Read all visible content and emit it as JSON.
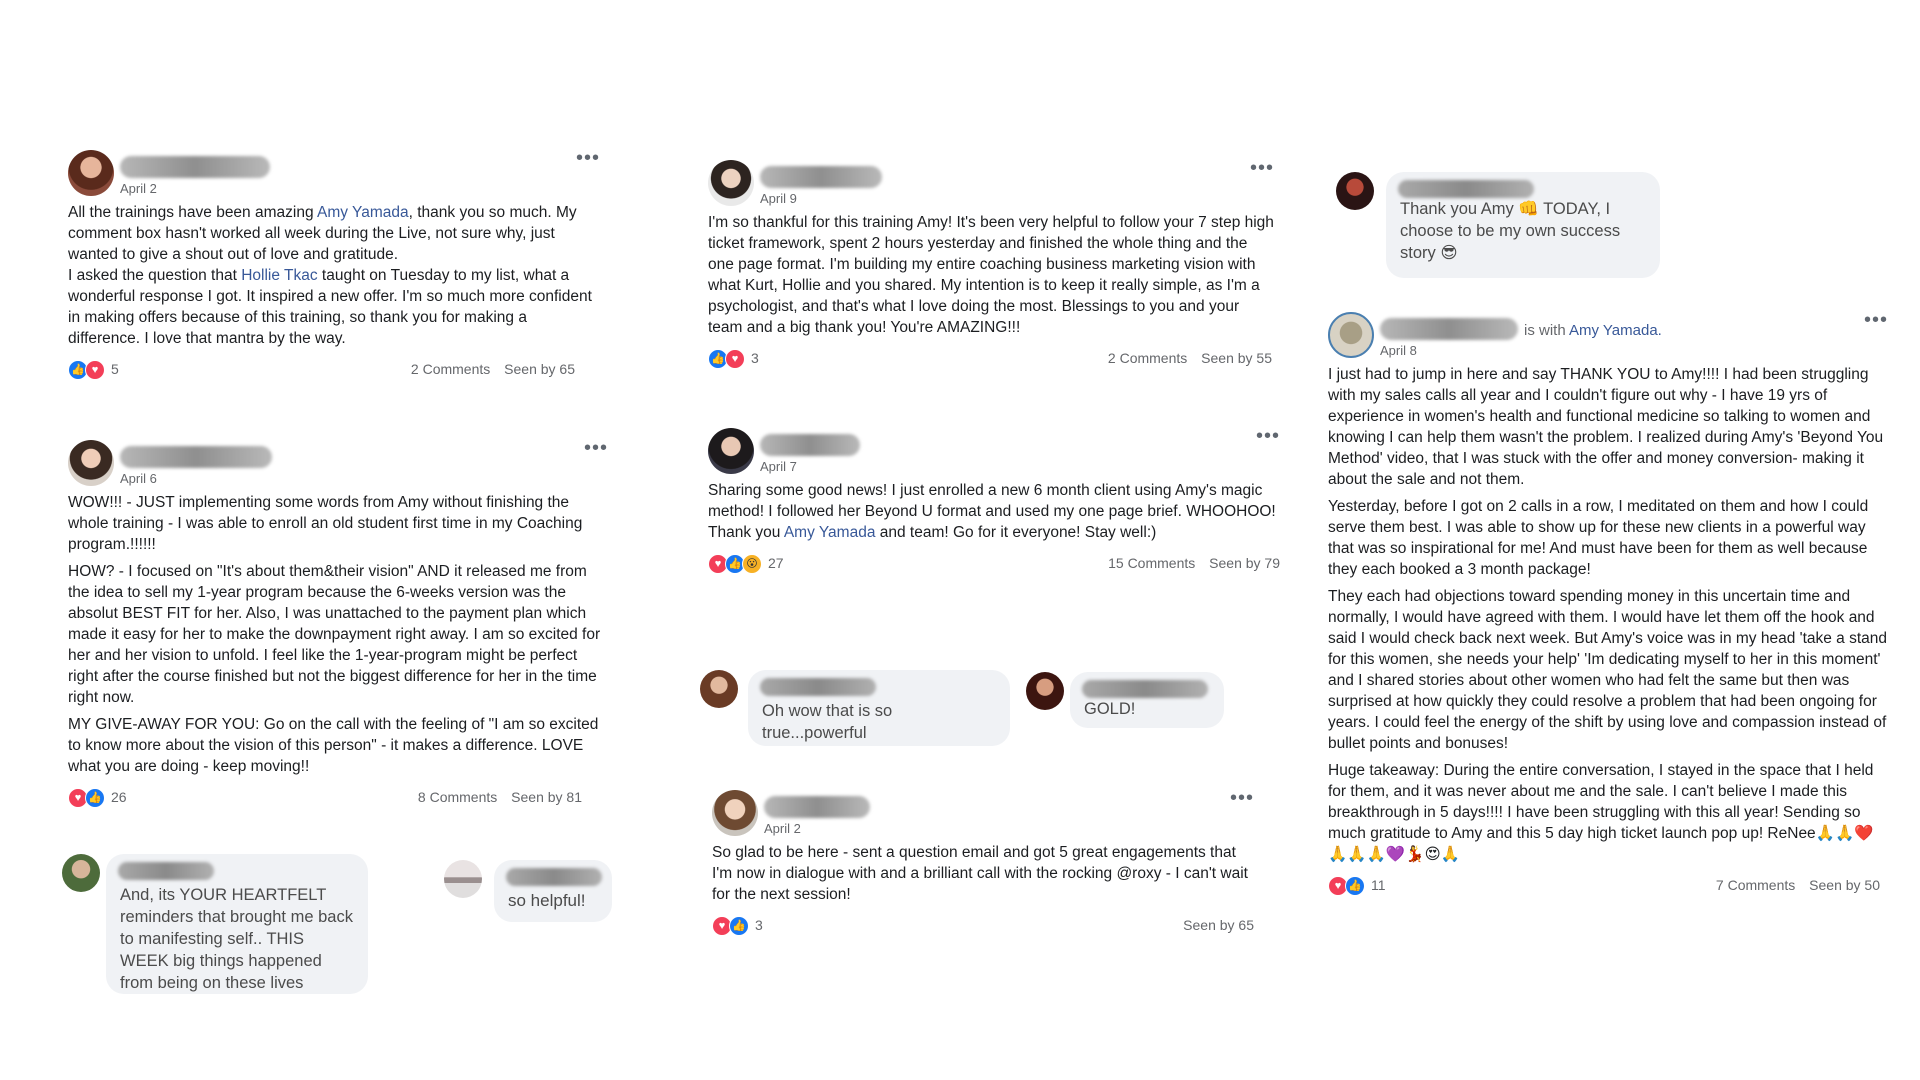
{
  "posts": {
    "p1": {
      "date": "April 2",
      "t1": "All the trainings have been amazing ",
      "m1": "Amy Yamada",
      "t2": ", thank you so much. My comment box hasn't worked all week during the Live, not sure why, just wanted to give a shout out of love and gratitude.",
      "t3": "I asked the question that ",
      "m2": "Hollie Tkac",
      "t4": " taught on Tuesday to my list, what a wonderful response I got. It inspired a new offer. I'm so much more confident in making offers because of this training, so thank you for making a difference. I love that mantra by the way.",
      "reactions": "5",
      "comments": "2 Comments",
      "seen": "Seen by 65"
    },
    "p2": {
      "date": "April 6",
      "para1": "WOW!!! - JUST implementing some words from Amy without finishing the whole training - I was able to enroll an old student first time in my Coaching program.!!!!!!",
      "para2": "HOW? - I focused on \"It's about them&their vision\" AND it released me from the idea to sell my 1-year program because the 6-weeks version was the absolut BEST FIT for her. Also, I was unattached to the payment plan which made it easy for her to make the downpayment right away. I am so excited for her and her vision to unfold. I feel like the 1-year-program might be perfect right after the course finished but not the biggest difference for her in the time right now.",
      "para3": "MY GIVE-AWAY FOR YOU: Go on the call with the feeling of \"I am so excited to know more about the vision of this person\" - it makes a difference. LOVE what you are doing - keep moving!!",
      "reactions": "26",
      "comments": "8 Comments",
      "seen": "Seen by 81"
    },
    "p3": {
      "date": "April 9",
      "text": "I'm so thankful for this training Amy! It's been very helpful to follow your 7 step high ticket framework, spent 2 hours yesterday and finished the whole thing and the one page format. I'm building my entire coaching business marketing vision with what Kurt, Hollie and you shared. My intention is to keep it really simple, as I'm a psychologist, and that's what I love doing the most. Blessings to you and your team and a big thank you! You're AMAZING!!!",
      "reactions": "3",
      "comments": "2 Comments",
      "seen": "Seen by 55"
    },
    "p4": {
      "date": "April 7",
      "t1": "Sharing some good news! I just enrolled a new 6 month client using Amy's magic method! I followed her Beyond U format and used my one page brief. WHOOHOO! Thank you ",
      "m1": "Amy Yamada",
      "t2": " and team! Go for it everyone! Stay well:)",
      "reactions": "27",
      "comments": "15 Comments",
      "seen": "Seen by 79"
    },
    "p5": {
      "date": "April 2",
      "text": "So glad to be here - sent a question email and got 5 great engagements that I'm now in dialogue with and a brilliant call with the rocking @roxy - I can't wait for the next session!",
      "reactions": "3",
      "seen": "Seen by 65"
    },
    "p6": {
      "date": "April 8",
      "with_text": "is with ",
      "with_name": "Amy Yamada.",
      "para1": "I just had to jump in here and say THANK YOU to Amy!!!! I had been struggling with my sales calls all year and I couldn't figure out why - I have 19 yrs of experience in women's health and functional medicine so talking to women and knowing I can help them wasn't the problem. I realized during Amy's 'Beyond You Method' video, that I was stuck with the offer and money conversion- making it about the sale and not them.",
      "para2": "Yesterday, before I got on 2 calls in a row, I meditated on them and how I could serve them best. I was able to show up for these new clients in a powerful way that was so inspirational for me! And must have been for them as well because they each booked a 3 month package!",
      "para3": "They each had objections toward spending money in this uncertain time and normally, I would have agreed with them. I would have let them off the hook and said I would check back next week. But Amy's voice was in my head 'take a stand for this women, she needs your help' 'Im dedicating myself to her in this moment' and I shared stories about other women who had felt the same but then was surprised at how quickly they could resolve a problem that had been ongoing for years. I could feel the energy of the shift by using love and compassion instead of bullet points and bonuses!",
      "para4": "Huge takeaway: During the entire conversation, I stayed in the space that I held for them, and it was never about me and the sale. I can't believe I made this breakthrough in 5 days!!!! I have been struggling with this all year! Sending so much gratitude to Amy and this 5 day high ticket launch pop up! ReNee🙏🙏❤️🙏🙏🙏💜💃😍🙏",
      "reactions": "11",
      "comments": "7 Comments",
      "seen": "Seen by 50"
    }
  },
  "comments": {
    "c1": "And, its YOUR HEARTFELT reminders that brought me back to manifesting self.. THIS WEEK big things happened from being on these lives",
    "c2": "so helpful!",
    "c3": "Oh wow that is so true...powerful",
    "c4": "GOLD!",
    "c5": "Thank you Amy 👊 TODAY, I choose to be my own success story 😎"
  },
  "ui": {
    "more": "•••",
    "like_icon": "👍",
    "love_icon": "♥",
    "wow_icon": "😮"
  },
  "colors": {
    "link": "#385898",
    "like": "#1877f2",
    "love": "#f33e58",
    "bubble": "#f0f2f5"
  }
}
